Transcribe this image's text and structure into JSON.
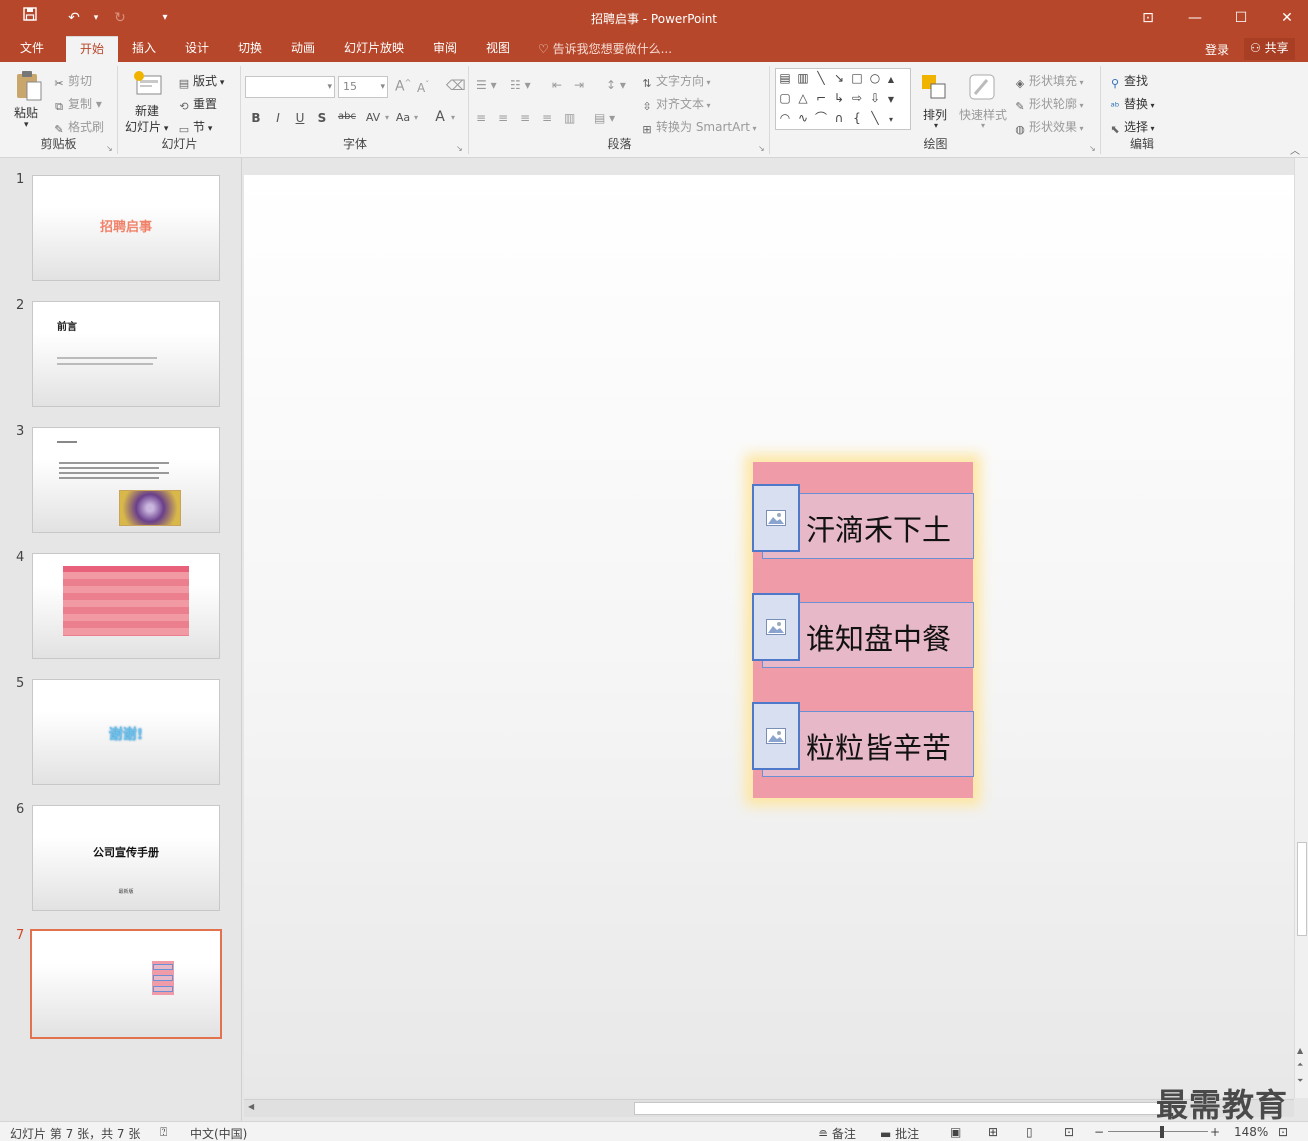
{
  "app": {
    "title": "招聘启事 - PowerPoint",
    "accent": "#b7472a"
  },
  "titlebar": {
    "save_icon": "save-icon",
    "undo_icon": "undo-icon",
    "redo_icon": "redo-icon",
    "customize_icon": "customize-quick-access-icon",
    "ribbon_display_icon": "ribbon-display-options-icon",
    "minimize_icon": "minimize-icon",
    "maximize_icon": "maximize-icon",
    "close_icon": "close-icon"
  },
  "tabs": [
    "文件",
    "开始",
    "插入",
    "设计",
    "切换",
    "动画",
    "幻灯片放映",
    "审阅",
    "视图"
  ],
  "active_tab": "开始",
  "tellme": "告诉我您想要做什么...",
  "login": "登录",
  "share": "共享",
  "ribbon": {
    "clipboard": {
      "paste": "粘贴",
      "cut": "剪切",
      "copy": "复制",
      "format_painter": "格式刷",
      "label": "剪贴板"
    },
    "slides": {
      "new_slide_line1": "新建",
      "new_slide_line2": "幻灯片",
      "layout": "版式",
      "reset": "重置",
      "section": "节",
      "label": "幻灯片"
    },
    "font": {
      "font_size": "15",
      "bold": "B",
      "italic": "I",
      "underline": "U",
      "shadow": "S",
      "strike": "abc",
      "spacing": "AV",
      "case": "Aa",
      "color": "A",
      "label": "字体"
    },
    "paragraph": {
      "text_direction": "文字方向",
      "align_text": "对齐文本",
      "smartart": "转换为 SmartArt",
      "label": "段落"
    },
    "drawing": {
      "arrange": "排列",
      "quick_styles": "快速样式",
      "shape_fill": "形状填充",
      "shape_outline": "形状轮廓",
      "shape_effects": "形状效果",
      "label": "绘图"
    },
    "editing": {
      "find": "查找",
      "replace": "替换",
      "select": "选择",
      "label": "编辑"
    }
  },
  "thumbnails": [
    {
      "num": "1",
      "title": "招聘启事"
    },
    {
      "num": "2",
      "title": "前言"
    },
    {
      "num": "3",
      "title": ""
    },
    {
      "num": "4",
      "title": ""
    },
    {
      "num": "5",
      "title": "谢谢!"
    },
    {
      "num": "6",
      "title": "公司宣传手册",
      "subtitle": "最新版"
    },
    {
      "num": "7",
      "title": ""
    }
  ],
  "active_slide": "7",
  "slide": {
    "items": [
      "汗滴禾下土",
      "谁知盘中餐",
      "粒粒皆辛苦"
    ]
  },
  "status": {
    "slide_info": "幻灯片 第 7 张，共 7 张",
    "language": "中文(中国)",
    "notes": "备注",
    "comments": "批注",
    "zoom": "148%"
  },
  "watermark": "最需教育"
}
